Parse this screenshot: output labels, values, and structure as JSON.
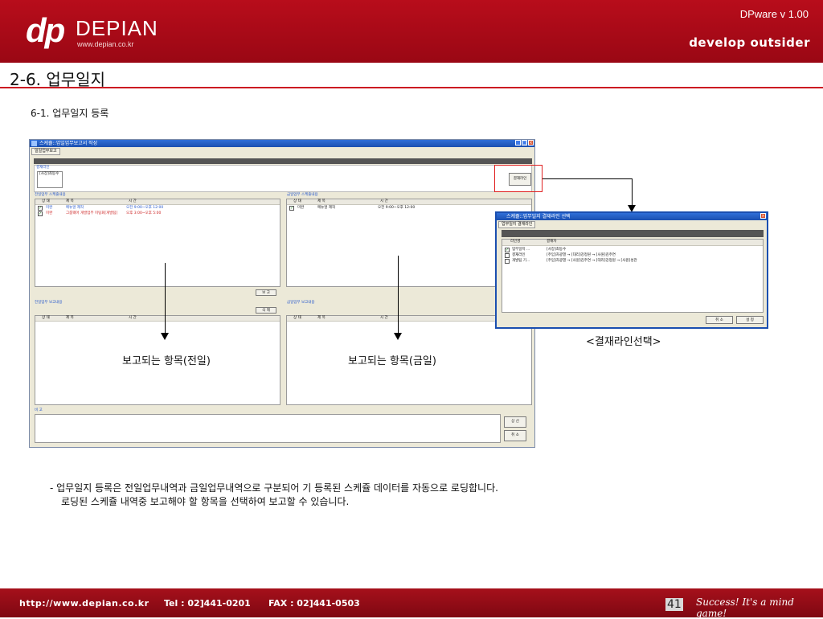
{
  "header": {
    "logo_mark": "dp",
    "logo_name": "DEPIAN",
    "logo_url": "www.depian.co.kr",
    "version": "DPware v 1.00",
    "tagline": "develop outsider"
  },
  "page_title": "2-6. 업무일지",
  "section_title": "6-1. 업무일지 등록",
  "window": {
    "title": "스케쥴::업일업무보고서 작성",
    "tab": "일일업무보고",
    "info_text": "[2007년10월2일] 일일업무보고서를 작성합니다.",
    "approval_label": "결재라인",
    "approval_value": "[사장]최동수",
    "approval_button": "결재라인",
    "prev_schedule_title": "전일업무 스케줄내용",
    "today_schedule_title": "금일업무 스케줄내용",
    "col_status": "상 태",
    "col_title": "제 목",
    "col_time": "시 간",
    "prev_rows": [
      {
        "status": "미완",
        "title": "메뉴얼 제작",
        "time": "오전 9:00~오후 12:00"
      },
      {
        "status": "미완",
        "title": "그룹웨어 개발업무 미팅회[개발팀]",
        "time": "오후 3:00~오후 5:00"
      }
    ],
    "today_rows": [
      {
        "status": "미완",
        "title": "메뉴얼 제작",
        "time": "오전 9:00~오후 12:00"
      }
    ],
    "report_button": "보 고",
    "delete_button": "삭 제",
    "prev_report_title": "전일업무 보고내용",
    "today_report_title": "금일업무 보고내용",
    "remarks_label": "비 고",
    "submit_button": "상 신",
    "cancel_button": "취 소"
  },
  "dialog": {
    "title": "스케쥴::업무일지 결재라인 선택",
    "tab": "업무일지 결재라인",
    "info_text": "업무일지 결재라인을 설정합니다.",
    "col_line": "라인명",
    "col_approver": "결재자",
    "rows": [
      {
        "checked": true,
        "name": "업무일지 ...",
        "approvers": "[사장]최동수"
      },
      {
        "checked": false,
        "name": "결재라인",
        "approvers": "[주임]차광열 → [대리]강정원 → [사원]김주연"
      },
      {
        "checked": false,
        "name": "개발팀 기...",
        "approvers": "[주임]차광열 → [사원]김주연 → [대리]강정원 → [사원]성관"
      }
    ],
    "cancel_button": "취 소",
    "confirm_button": "설 정"
  },
  "captions": {
    "dialog_caption": "<결재라인선택>",
    "prev_caption": "보고되는 항목(전일)",
    "today_caption": "보고되는 항목(금일)"
  },
  "description": {
    "line1": "- 업무일지 등록은 전일업무내역과 금일업무내역으로 구분되어 기 등록된 스케쥴 데이터를 자동으로 로딩합니다.",
    "line2": "로딩된 스케쥴 내역중 보고해야 할 항목을 선택하여 보고할 수 있습니다."
  },
  "footer": {
    "url": "http://www.depian.co.kr",
    "tel": "Tel : 02]441-0201",
    "fax": "FAX : 02]441-0503",
    "page_number": "41",
    "slogan": "Success! It's a mind game!"
  }
}
